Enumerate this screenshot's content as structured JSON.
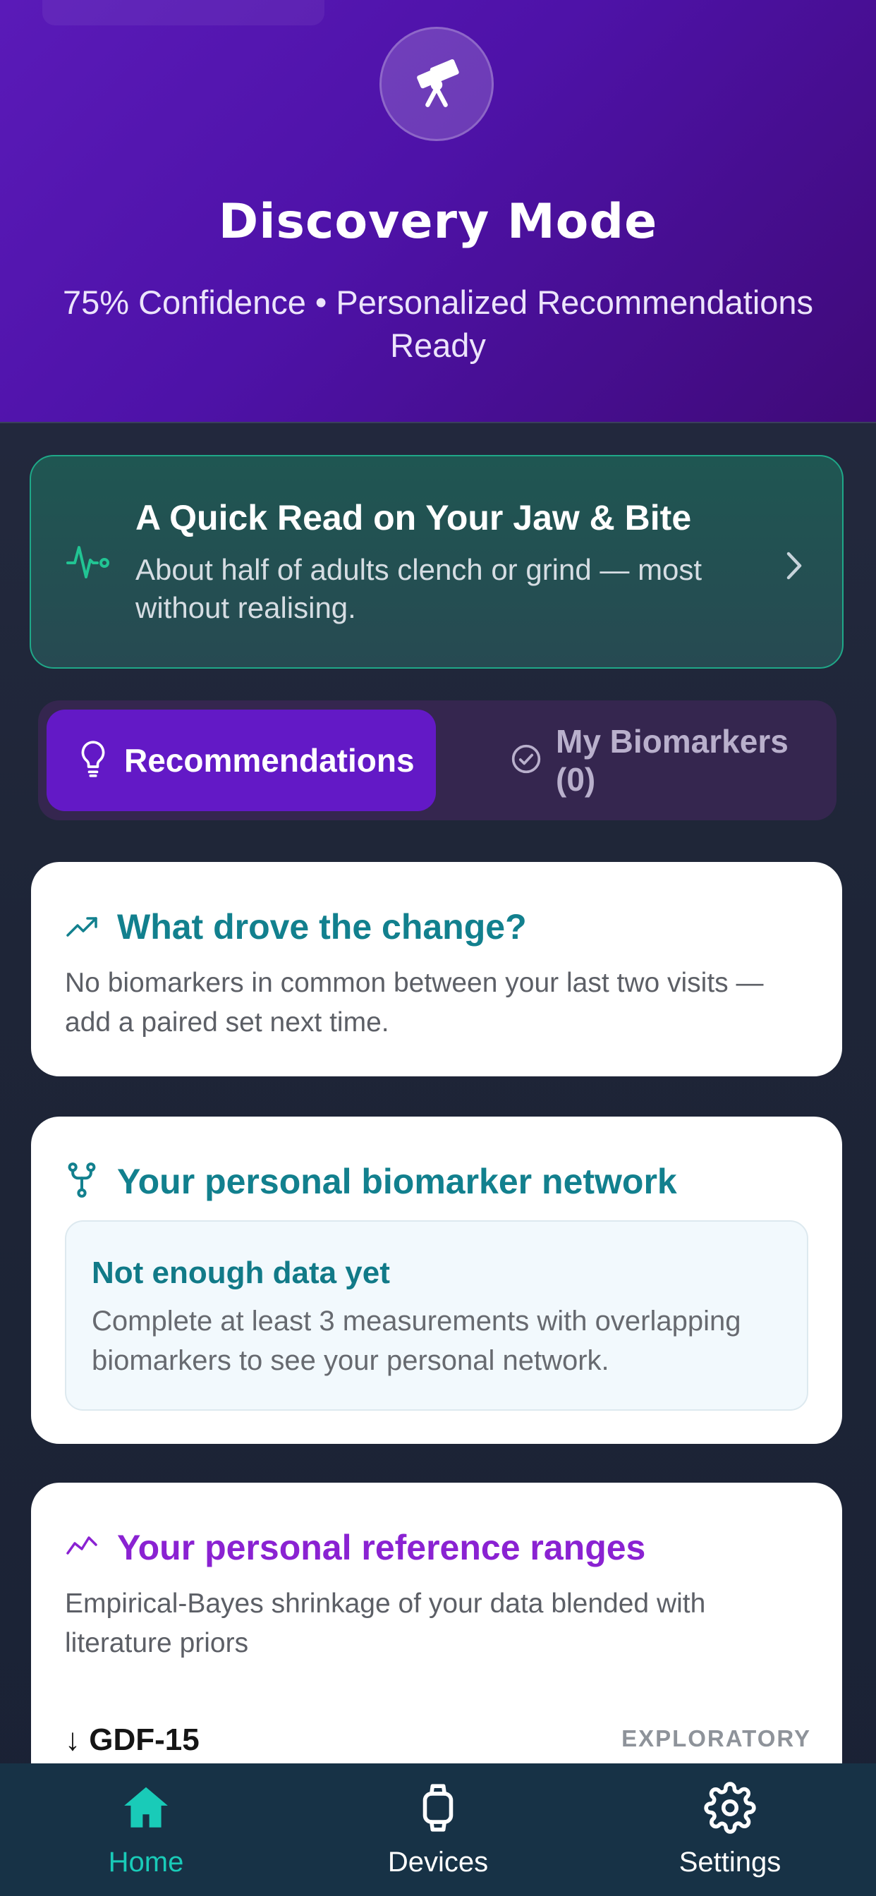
{
  "header": {
    "badge_icon": "telescope-icon",
    "title": "Discovery Mode",
    "subtitle": "75% Confidence • Personalized Recommendations Ready",
    "colors": {
      "gradient_start": "#5a1ab8",
      "gradient_end": "#3f0a78"
    }
  },
  "quick_read": {
    "icon": "heart-pulse-icon",
    "title": "A Quick Read on Your Jaw & Bite",
    "body": "About half of adults clench or grind — most without realising.",
    "accent": "#1fa888"
  },
  "tabs": [
    {
      "label": "Recommendations",
      "icon": "lightbulb-icon",
      "active": true
    },
    {
      "label": "My Biomarkers (0)",
      "icon": "check-circle-icon",
      "active": false
    }
  ],
  "change_card": {
    "icon": "trending-up-icon",
    "title": "What drove the change?",
    "body": "No biomarkers in common between your last two visits — add a paired set next time."
  },
  "network_card": {
    "icon": "network-fork-icon",
    "title": "Your personal biomarker network",
    "empty_title": "Not enough data yet",
    "empty_body": "Complete at least 3 measurements with overlapping biomarkers to see your personal network."
  },
  "ranges_card": {
    "icon": "line-chart-icon",
    "title": "Your personal reference ranges",
    "body": "Empirical-Bayes shrinkage of your data blended with literature priors",
    "rows": [
      {
        "label": "↓ GDF-15",
        "tag": "EXPLORATORY"
      }
    ],
    "title_color": "#8a22d2"
  },
  "nav": [
    {
      "label": "Home",
      "icon": "home-icon",
      "active": true
    },
    {
      "label": "Devices",
      "icon": "watch-icon",
      "active": false
    },
    {
      "label": "Settings",
      "icon": "gear-icon",
      "active": false
    }
  ]
}
